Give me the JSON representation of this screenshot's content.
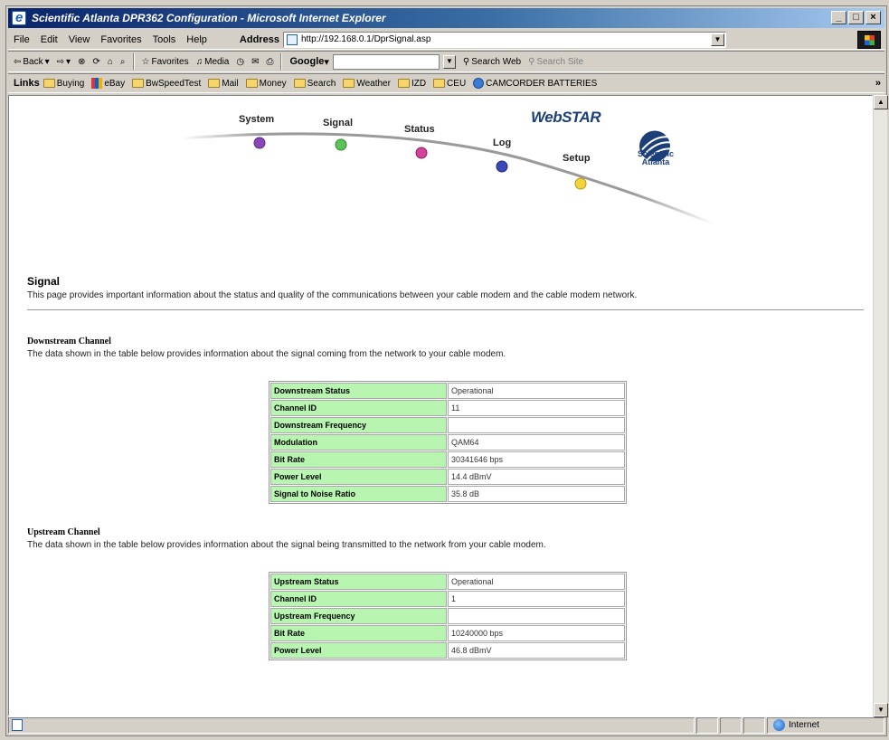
{
  "window": {
    "title": "Scientific Atlanta DPR362 Configuration - Microsoft Internet Explorer",
    "controls": [
      "_",
      "□",
      "×"
    ]
  },
  "menubar": {
    "items": [
      "File",
      "Edit",
      "View",
      "Favorites",
      "Tools",
      "Help"
    ],
    "address_label": "Address",
    "address_value": "http://192.168.0.1/DprSignal.asp"
  },
  "toolbar": {
    "back": "Back",
    "favorites": "Favorites",
    "media": "Media",
    "google": "Google",
    "search_web": "Search Web",
    "search_site": "Search Site"
  },
  "linksbar": {
    "label": "Links",
    "items": [
      "Buying",
      "eBay",
      "BwSpeedTest",
      "Mail",
      "Money",
      "Search",
      "Weather",
      "IZD",
      "CEU",
      "CAMCORDER BATTERIES"
    ]
  },
  "nav": {
    "items": [
      "System",
      "Signal",
      "Status",
      "Log",
      "Setup"
    ],
    "colors": [
      "#8a46b8",
      "#5ec25a",
      "#d0449a",
      "#3c48b8",
      "#f3d23a"
    ],
    "brand": "WebSTAR",
    "company": "Scientific Atlanta"
  },
  "page": {
    "title": "Signal",
    "description": "This page provides important information about the status and quality of the communications between your cable modem and the cable modem network."
  },
  "downstream": {
    "title": "Downstream Channel",
    "description": "The data shown in the table below provides information about the signal coming from the network to your cable modem.",
    "rows": [
      {
        "label": "Downstream Status",
        "value": "Operational"
      },
      {
        "label": "Channel ID",
        "value": "11"
      },
      {
        "label": "Downstream Frequency",
        "value": ""
      },
      {
        "label": "Modulation",
        "value": "QAM64"
      },
      {
        "label": "Bit Rate",
        "value": "30341646 bps"
      },
      {
        "label": "Power Level",
        "value": "14.4 dBmV"
      },
      {
        "label": "Signal to Noise Ratio",
        "value": "35.8 dB"
      }
    ]
  },
  "upstream": {
    "title": "Upstream Channel",
    "description": "The data shown in the table below provides information about the signal being transmitted to the network from your cable modem.",
    "rows": [
      {
        "label": "Upstream Status",
        "value": "Operational"
      },
      {
        "label": "Channel ID",
        "value": "1"
      },
      {
        "label": "Upstream Frequency",
        "value": ""
      },
      {
        "label": "Bit Rate",
        "value": "10240000 bps"
      },
      {
        "label": "Power Level",
        "value": "46.8 dBmV"
      }
    ]
  },
  "statusbar": {
    "zone": "Internet"
  }
}
